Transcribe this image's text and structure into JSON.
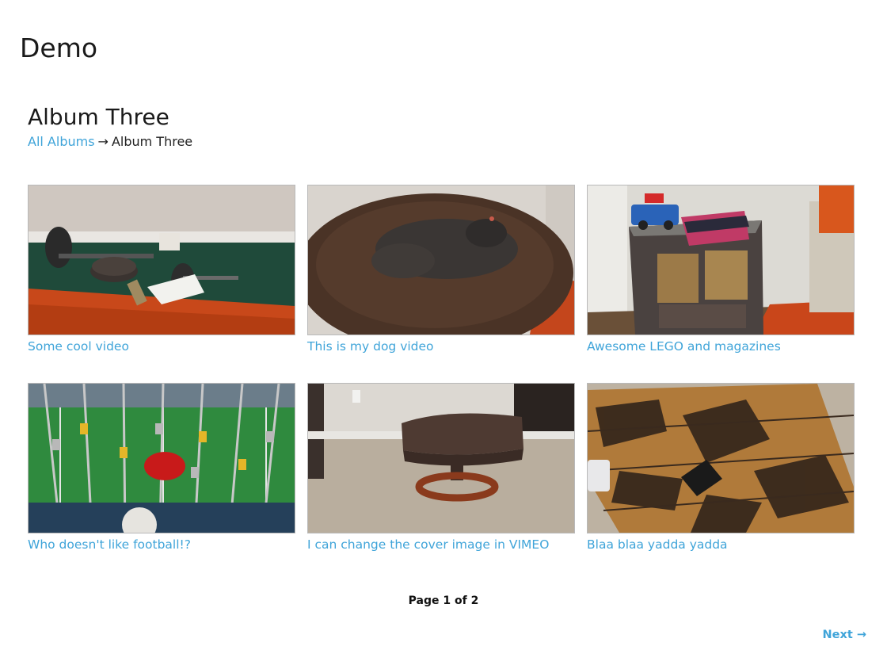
{
  "site": {
    "title": "Demo"
  },
  "album": {
    "title": "Album Three"
  },
  "breadcrumb": {
    "root_label": "All Albums",
    "separator": "→",
    "current_label": "Album Three"
  },
  "videos": [
    {
      "caption": "Some cool video"
    },
    {
      "caption": "This is my dog video"
    },
    {
      "caption": "Awesome LEGO and magazines"
    },
    {
      "caption": "Who doesn't like football!?"
    },
    {
      "caption": "I can change the cover image in VIMEO"
    },
    {
      "caption": "Blaa blaa yadda yadda"
    }
  ],
  "pagination": {
    "status": "Page 1 of 2",
    "next_label": "Next →"
  },
  "colors": {
    "link": "#3fa4d9",
    "text": "#222222",
    "thumb_border": "#b9b9b9"
  }
}
